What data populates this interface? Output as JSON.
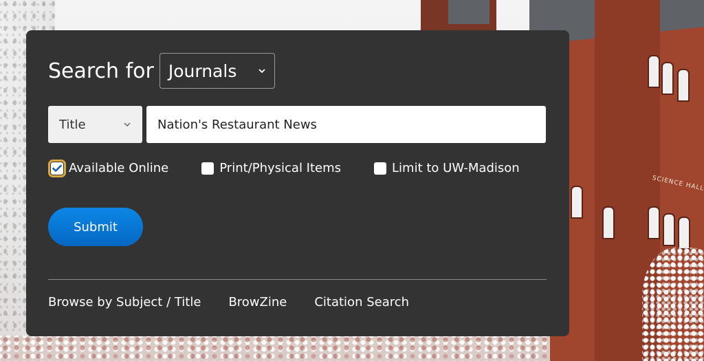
{
  "search": {
    "label": "Search for",
    "type_selected": "Journals",
    "field_selected": "Title",
    "query": "Nation's Restaurant News"
  },
  "filters": [
    {
      "label": "Available Online",
      "checked": true
    },
    {
      "label": "Print/Physical Items",
      "checked": false
    },
    {
      "label": "Limit to UW-Madison",
      "checked": false
    }
  ],
  "submit_label": "Submit",
  "links": [
    {
      "label": "Browse by Subject / Title"
    },
    {
      "label": "BrowZine"
    },
    {
      "label": "Citation Search"
    }
  ],
  "background_sign": "SCIENCE HALL",
  "colors": {
    "panel": "#333333",
    "submit": "#0a7bdc",
    "focus_outline": "#d8a941"
  },
  "icons": {
    "dropdown": "chevron-down-icon",
    "check": "checkmark-icon"
  }
}
